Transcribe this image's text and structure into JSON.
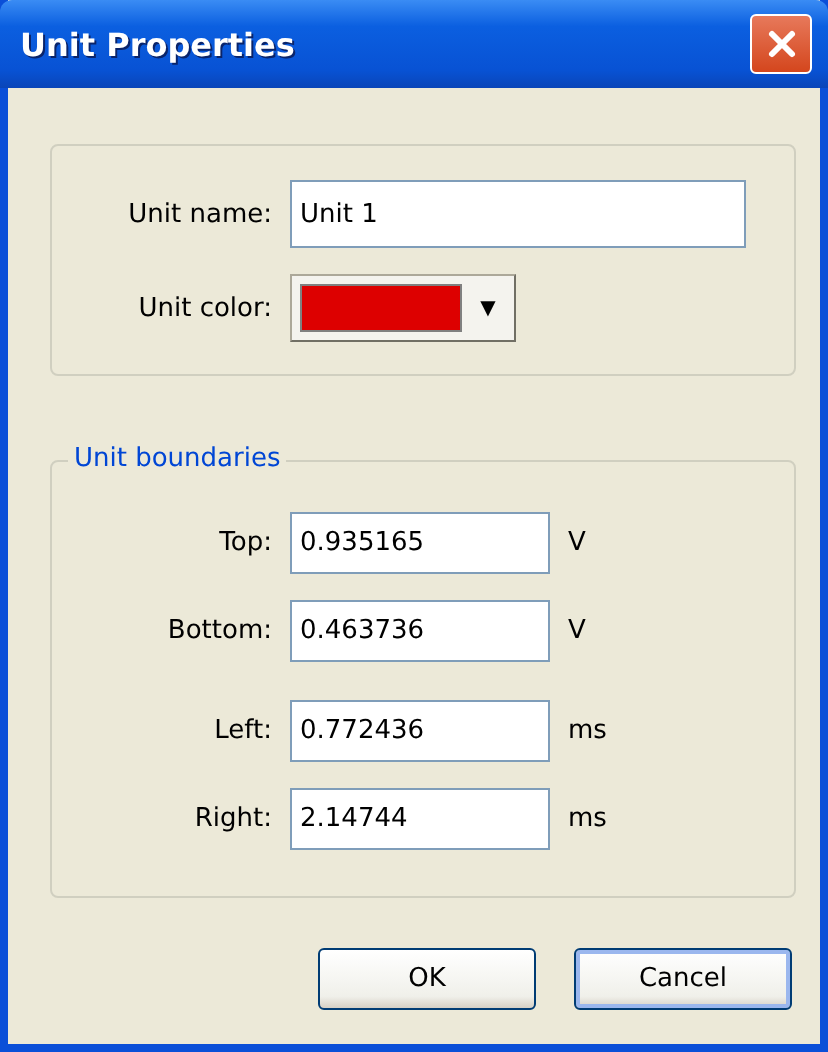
{
  "window": {
    "title": "Unit Properties"
  },
  "unit": {
    "name_label": "Unit name:",
    "name_value": "Unit 1",
    "color_label": "Unit color:",
    "color": "#dd0000",
    "dropdown_glyph": "▼"
  },
  "boundaries": {
    "title": "Unit boundaries",
    "rows": [
      {
        "label": "Top:",
        "value": "0.935165",
        "unit": "V"
      },
      {
        "label": "Bottom:",
        "value": "0.463736",
        "unit": "V"
      },
      {
        "label": "Left:",
        "value": "0.772436",
        "unit": "ms"
      },
      {
        "label": "Right:",
        "value": "2.14744",
        "unit": "ms"
      }
    ]
  },
  "buttons": [
    {
      "label": "OK",
      "default": false
    },
    {
      "label": "Cancel",
      "default": true
    }
  ]
}
